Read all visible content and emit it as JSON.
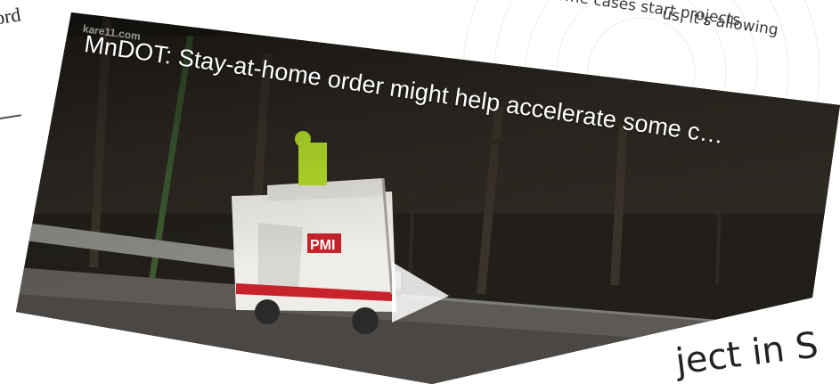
{
  "article": {
    "left_fragment": "ord",
    "top_line_1": "us, it's allowing",
    "top_line_2": "d in some cases start projects",
    "heading_fragment": "ject in S"
  },
  "video": {
    "title": "MnDOT: Stay-at-home order might help accelerate some c…",
    "logo": "kare11.com",
    "truck_brand": "PMI",
    "play_icon": "play-icon"
  },
  "colors": {
    "title_text": "#ffffff",
    "video_background": "#1b1916",
    "truck_body": "#f1efe9",
    "truck_stripe": "#c8232c",
    "worker_vest": "#b6e12b"
  }
}
